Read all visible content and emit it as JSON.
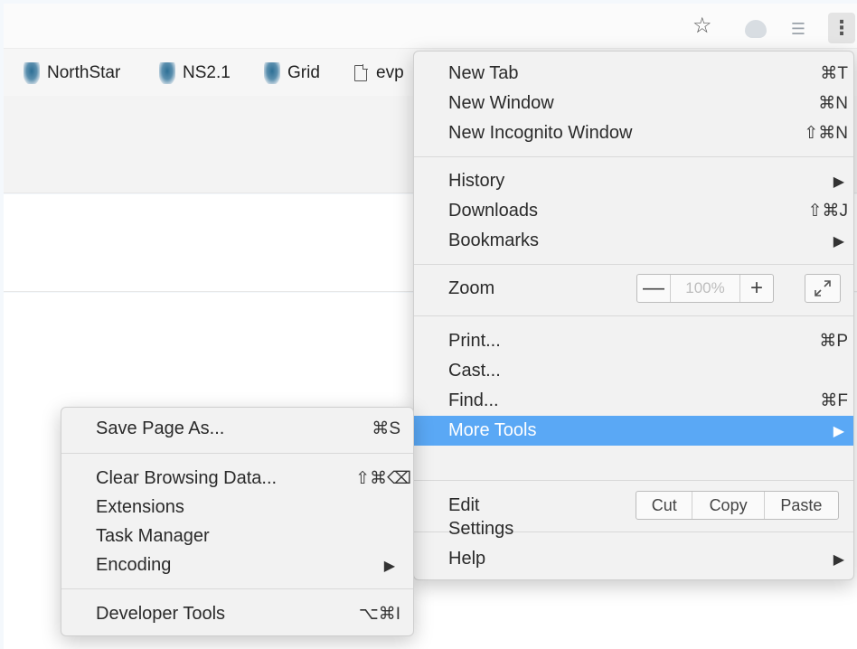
{
  "toolbar": {
    "star_icon": "star-outline-icon",
    "extension1_icon": "extension-icon",
    "extension2_icon": "list-extension-icon",
    "menu_icon": "vertical-ellipsis-icon"
  },
  "bookmarks": [
    {
      "label": "NorthStar",
      "icon": "favicon"
    },
    {
      "label": "NS2.1",
      "icon": "favicon"
    },
    {
      "label": "Grid",
      "icon": "favicon"
    },
    {
      "label": "evp",
      "icon": "page-icon"
    }
  ],
  "main_menu": {
    "new_tab": {
      "label": "New Tab",
      "shortcut": "⌘T"
    },
    "new_window": {
      "label": "New Window",
      "shortcut": "⌘N"
    },
    "new_incognito": {
      "label": "New Incognito Window",
      "shortcut": "⇧⌘N"
    },
    "history": {
      "label": "History"
    },
    "downloads": {
      "label": "Downloads",
      "shortcut": "⇧⌘J"
    },
    "bookmarks": {
      "label": "Bookmarks"
    },
    "zoom": {
      "label": "Zoom",
      "minus": "—",
      "value": "100%",
      "plus": "+"
    },
    "print": {
      "label": "Print...",
      "shortcut": "⌘P"
    },
    "cast": {
      "label": "Cast..."
    },
    "find": {
      "label": "Find...",
      "shortcut": "⌘F"
    },
    "more_tools": {
      "label": "More Tools"
    },
    "edit": {
      "label": "Edit",
      "cut": "Cut",
      "copy": "Copy",
      "paste": "Paste"
    },
    "settings": {
      "label": "Settings"
    },
    "help": {
      "label": "Help"
    }
  },
  "sub_menu": {
    "save_page": {
      "label": "Save Page As...",
      "shortcut": "⌘S"
    },
    "clear_data": {
      "label": "Clear Browsing Data...",
      "shortcut": "⇧⌘⌫"
    },
    "extensions": {
      "label": "Extensions"
    },
    "task_manager": {
      "label": "Task Manager"
    },
    "encoding": {
      "label": "Encoding"
    },
    "dev_tools": {
      "label": "Developer Tools",
      "shortcut": "⌥⌘I"
    }
  },
  "colors": {
    "highlight": "#5aa8f5",
    "menu_bg": "#f2f2f2"
  }
}
